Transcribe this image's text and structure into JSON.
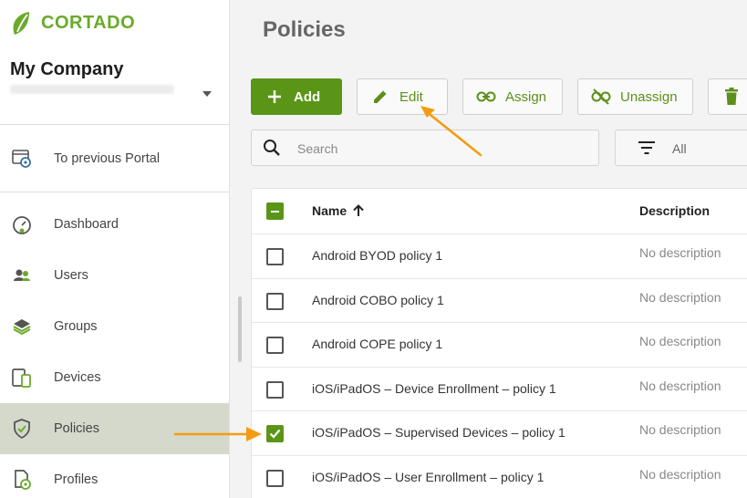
{
  "brand": {
    "name": "CORTADO",
    "color": "#6aaa2a"
  },
  "company": {
    "name": "My Company"
  },
  "sidebar": {
    "items": [
      {
        "label": "To previous Portal",
        "icon": "portal-icon"
      },
      {
        "label": "Dashboard",
        "icon": "dashboard-icon"
      },
      {
        "label": "Users",
        "icon": "users-icon"
      },
      {
        "label": "Groups",
        "icon": "groups-icon"
      },
      {
        "label": "Devices",
        "icon": "devices-icon"
      },
      {
        "label": "Policies",
        "icon": "shield-icon",
        "active": true
      },
      {
        "label": "Profiles",
        "icon": "profiles-icon"
      }
    ]
  },
  "page": {
    "title": "Policies"
  },
  "toolbar": {
    "add_label": "Add",
    "edit_label": "Edit",
    "assign_label": "Assign",
    "unassign_label": "Unassign",
    "delete_icon": "trash-icon",
    "accent": "#5b9517"
  },
  "search": {
    "placeholder": "Search",
    "value": ""
  },
  "filter": {
    "label": "All"
  },
  "table": {
    "columns": [
      "Name",
      "Description"
    ],
    "sort": "ascending",
    "rows": [
      {
        "name": "Android BYOD policy 1",
        "description": "No description",
        "checked": false
      },
      {
        "name": "Android COBO policy 1",
        "description": "No description",
        "checked": false
      },
      {
        "name": "Android COPE policy 1",
        "description": "No description",
        "checked": false
      },
      {
        "name": "iOS/iPadOS – Device Enrollment – policy 1",
        "description": "No description",
        "checked": false
      },
      {
        "name": "iOS/iPadOS – Supervised Devices – policy 1",
        "description": "No description",
        "checked": true
      },
      {
        "name": "iOS/iPadOS – User Enrollment – policy 1",
        "description": "No description",
        "checked": false
      }
    ]
  },
  "annotation_color": "#f39c12"
}
